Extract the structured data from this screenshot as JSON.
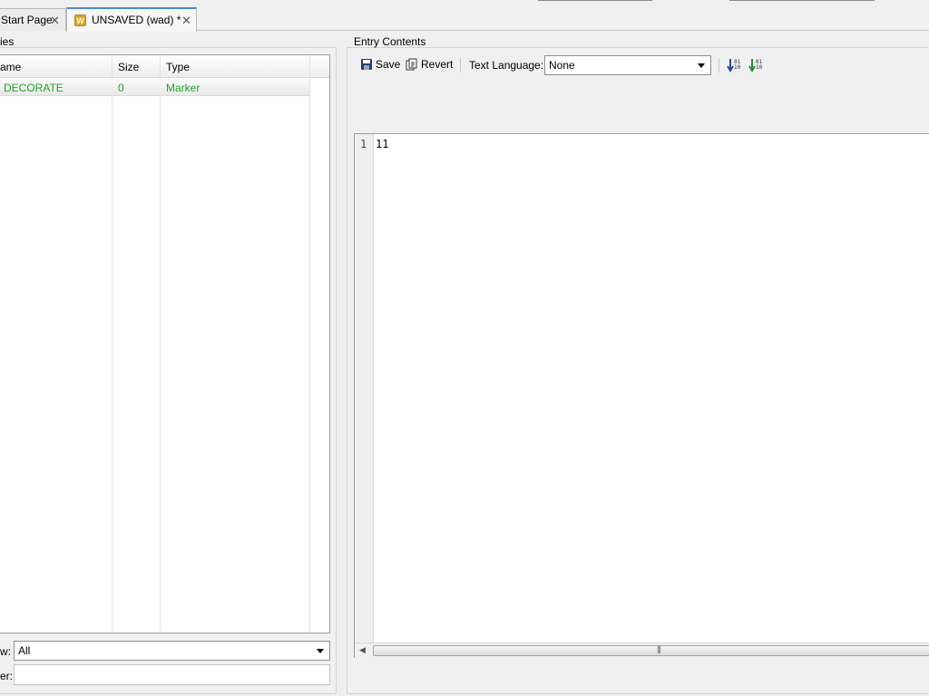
{
  "tabs": [
    {
      "label": "Start Page"
    },
    {
      "label": "UNSAVED (wad) *"
    }
  ],
  "entries_panel": {
    "title": "ies",
    "columns": [
      "ame",
      "Size",
      "Type"
    ],
    "rows": [
      {
        "name": "DECORATE",
        "size": "0",
        "type": "Marker"
      }
    ],
    "view_label": "w:",
    "view_value": "All",
    "filter_label": "er:",
    "filter_value": ""
  },
  "entry_contents": {
    "title": "Entry Contents",
    "save_label": "Save",
    "revert_label": "Revert",
    "text_language_label": "Text Language:",
    "text_language_value": "None",
    "editor": {
      "line_numbers": [
        "1"
      ],
      "lines": [
        "11"
      ]
    }
  },
  "colors": {
    "entry_text": "#22a22a",
    "active_tab_accent": "#4a88d1"
  }
}
